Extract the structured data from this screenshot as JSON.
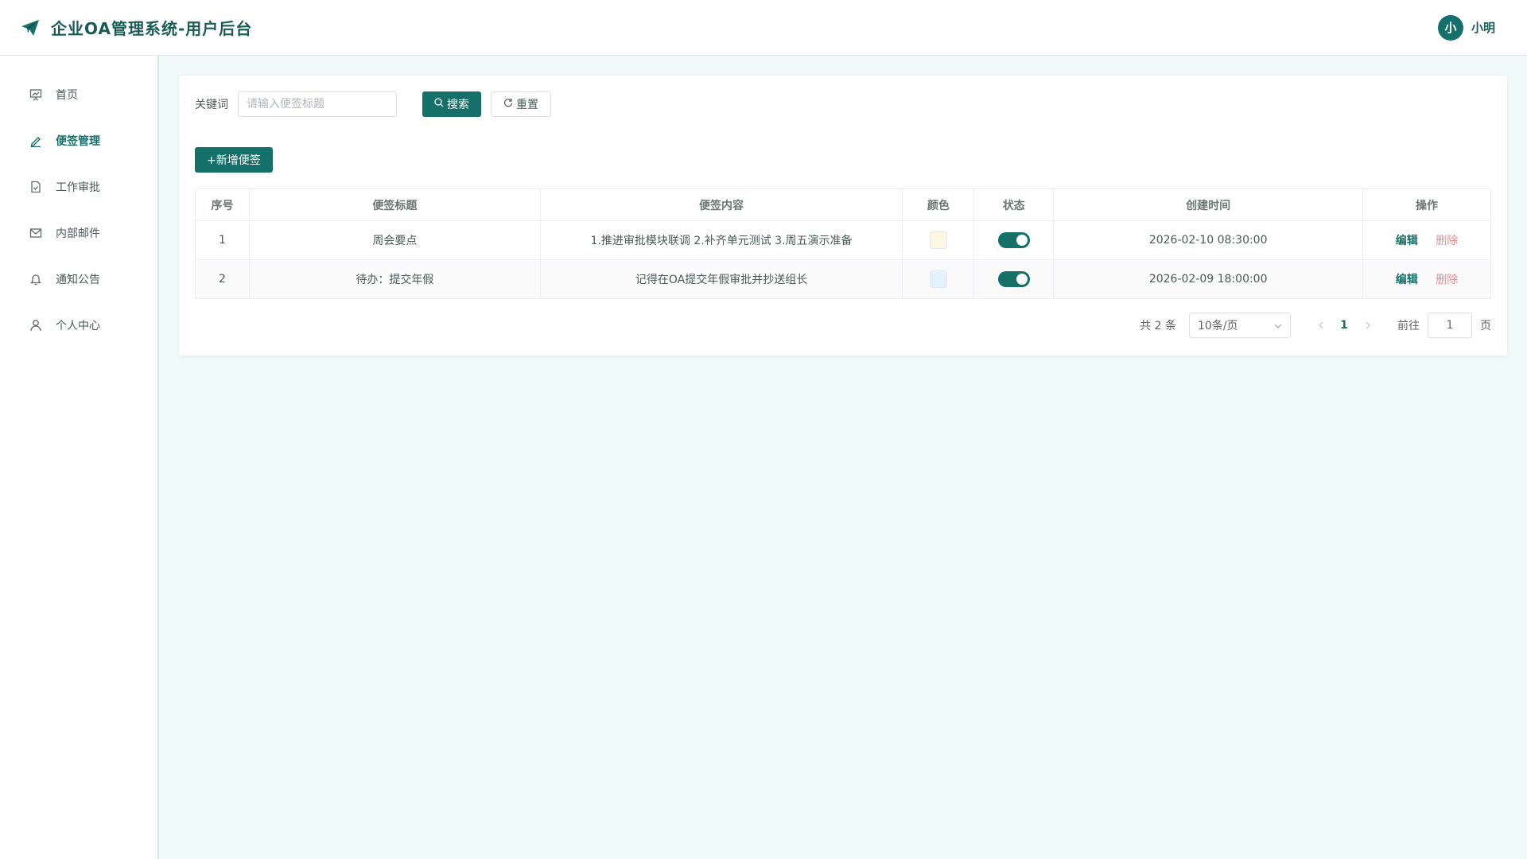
{
  "header": {
    "title": "企业OA管理系统-用户后台",
    "avatar_text": "小",
    "username": "小明"
  },
  "sidebar": {
    "items": [
      {
        "label": "首页",
        "icon": "presentation-icon",
        "active": false
      },
      {
        "label": "便签管理",
        "icon": "pen-icon",
        "active": true
      },
      {
        "label": "工作审批",
        "icon": "document-check-icon",
        "active": false
      },
      {
        "label": "内部邮件",
        "icon": "mail-icon",
        "active": false
      },
      {
        "label": "通知公告",
        "icon": "bell-icon",
        "active": false
      },
      {
        "label": "个人中心",
        "icon": "user-icon",
        "active": false
      }
    ]
  },
  "search": {
    "label": "关键词",
    "placeholder": "请输入便签标题",
    "value": "",
    "search_button": "搜索",
    "reset_button": "重置"
  },
  "toolbar": {
    "add_button": "+新增便签"
  },
  "table": {
    "columns": [
      "序号",
      "便签标题",
      "便签内容",
      "颜色",
      "状态",
      "创建时间",
      "操作"
    ],
    "rows": [
      {
        "index": "1",
        "title": "周会要点",
        "content": "1.推进审批模块联调 2.补齐单元测试 3.周五演示准备",
        "color": "#fdf7e1",
        "status_on": true,
        "created": "2026-02-10 08:30:00"
      },
      {
        "index": "2",
        "title": "待办：提交年假",
        "content": "记得在OA提交年假审批并抄送组长",
        "color": "#e3f2fb",
        "status_on": true,
        "created": "2026-02-09 18:00:00"
      }
    ],
    "edit_label": "编辑",
    "delete_label": "删除"
  },
  "pagination": {
    "total_text": "共 2 条",
    "page_size": "10条/页",
    "current_page": "1",
    "goto_label": "前往",
    "goto_value": "1",
    "page_unit": "页"
  },
  "colors": {
    "primary": "#16706a",
    "danger_link": "#f08a8a",
    "page_bg": "#f0fbf9"
  }
}
